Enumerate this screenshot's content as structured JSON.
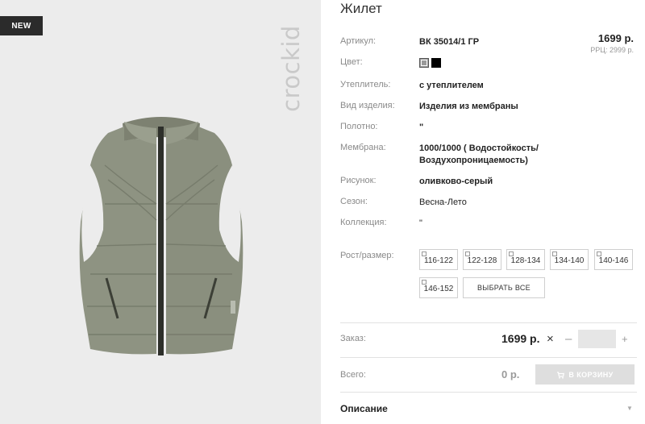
{
  "badge": {
    "new": "NEW"
  },
  "brand": {
    "logo_text": "crockid"
  },
  "product": {
    "title": "Жилет",
    "price": "1699 р.",
    "rrp": "РРЦ: 2999 р."
  },
  "attributes": [
    {
      "label": "Артикул:",
      "value": "ВК 35014/1 ГР"
    },
    {
      "label": "Цвет:",
      "value": ""
    },
    {
      "label": "Утеплитель:",
      "value": "с утеплителем"
    },
    {
      "label": "Вид изделия:",
      "value": "Изделия из мембраны"
    },
    {
      "label": "Полотно:",
      "value": "\""
    },
    {
      "label": "Мембрана:",
      "value": "1000/1000 ( Водостойкость/ Воздухопроницаемость)"
    },
    {
      "label": "Рисунок:",
      "value": "оливково-серый"
    },
    {
      "label": "Сезон:",
      "value": "Весна-Лето"
    },
    {
      "label": "Коллекция:",
      "value": "\""
    }
  ],
  "colors": [
    {
      "name": "grey",
      "hex": "#9a9a9a"
    },
    {
      "name": "black",
      "hex": "#000000"
    }
  ],
  "sizes": {
    "label": "Рост/размер:",
    "options": [
      "116-122",
      "122-128",
      "128-134",
      "134-140",
      "140-146",
      "146-152"
    ],
    "select_all": "ВЫБРАТЬ ВСЕ"
  },
  "order": {
    "label": "Заказ:",
    "price": "1699 р.",
    "times": "×",
    "minus": "–",
    "plus": "+",
    "quantity": ""
  },
  "total": {
    "label": "Всего:",
    "value": "0 р.",
    "cart_button": "В КОРЗИНУ"
  },
  "description": {
    "title": "Описание",
    "chevron": "▼"
  }
}
